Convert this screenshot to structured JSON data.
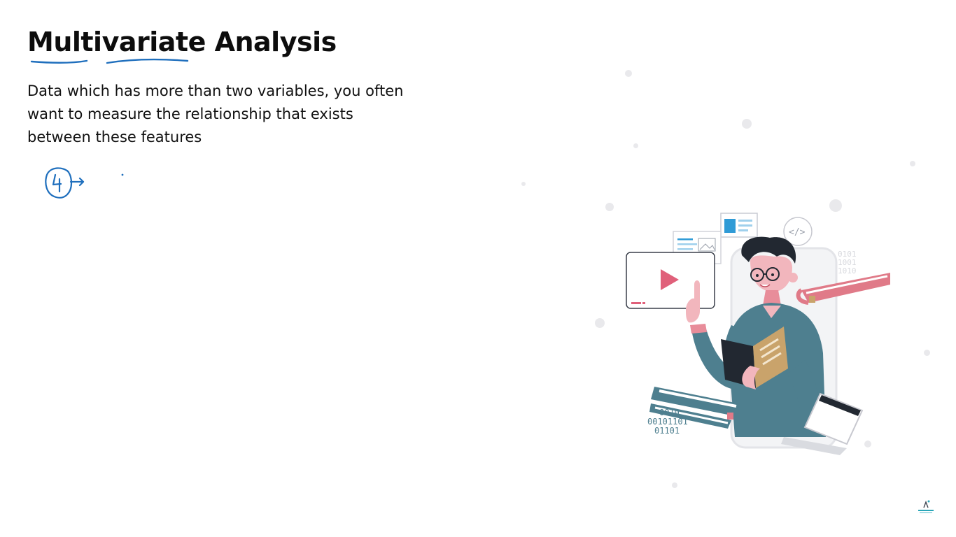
{
  "slide": {
    "title": "Multivariate Analysis",
    "description": "Data which has more than two variables, you often want to measure the relationship that exists between these features",
    "annotation": {
      "ink_color": "#1f6fbd",
      "marks": [
        "underline-multi",
        "underline-variate",
        "circled-number-with-arrow"
      ]
    }
  },
  "illustration": {
    "icons": [
      "code-brackets-icon",
      "video-play-icon",
      "dashboard-card-icon",
      "image-card-icon",
      "book-icon",
      "laptop-icon",
      "binary-code-icon"
    ],
    "binary_top": [
      "0101",
      "1001",
      "1010"
    ],
    "binary_bottom": [
      "0010",
      "00101101",
      "01101"
    ],
    "colors": {
      "teal": "#4e7f8f",
      "pink": "#e07a88",
      "dark": "#222831",
      "blue": "#2f9bd6",
      "book_tan": "#c9a36b"
    }
  }
}
